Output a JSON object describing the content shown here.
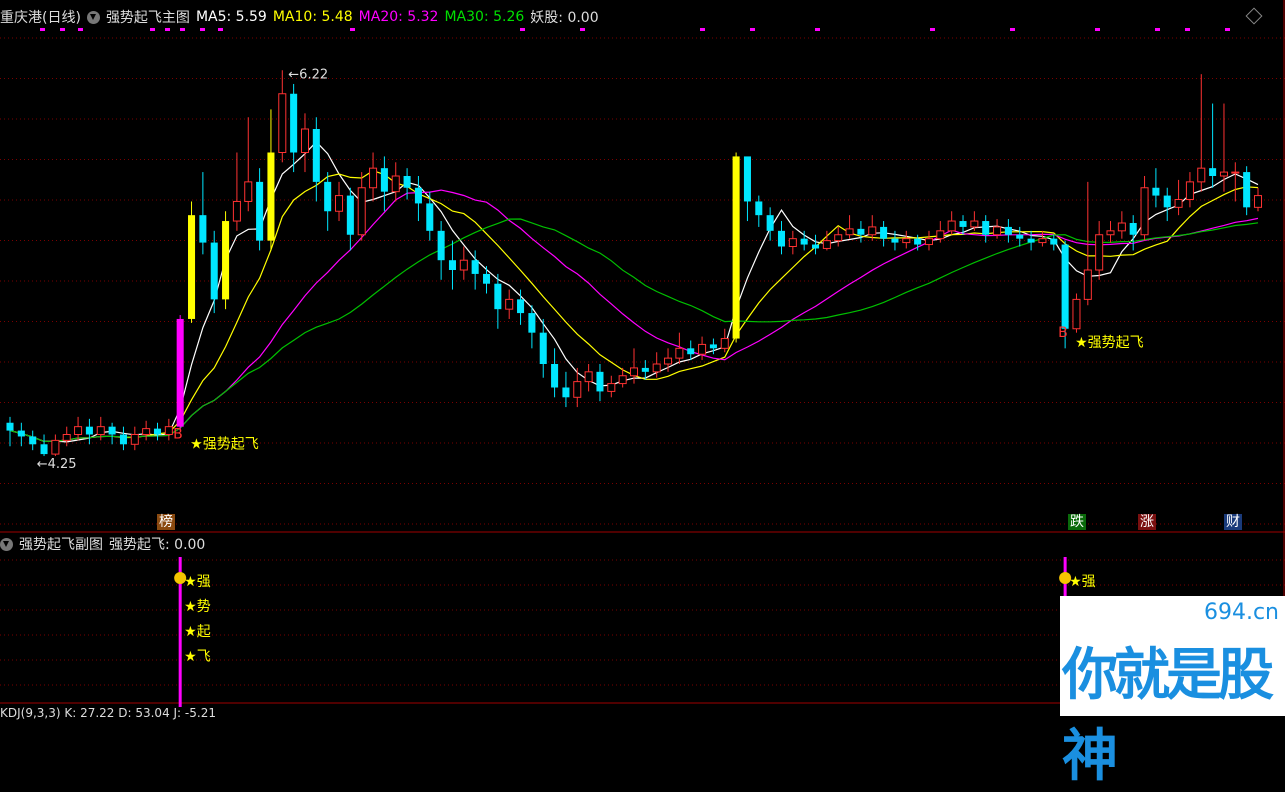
{
  "main_header": {
    "title": "重庆港(日线)",
    "indicator_name": "强势起飞主图",
    "ma5": "MA5: 5.59",
    "ma10": "MA10: 5.48",
    "ma20": "MA20: 5.32",
    "ma30": "MA30: 5.26",
    "yaogu": "妖股: 0.00"
  },
  "sub_header": {
    "indicator_name": "强势起飞副图",
    "value": "强势起飞: 0.00"
  },
  "bottom_header": {
    "text": "KDJ(9,3,3)  K: 27.22  D: 53.04  J: -5.21"
  },
  "badges": {
    "bang": "榜",
    "die": "跌",
    "zhang": "涨",
    "cai": "财"
  },
  "watermark": {
    "site": "694.cn",
    "slogan": "你就是股神"
  },
  "colors": {
    "up": "#ff3232",
    "down": "#00e6ff",
    "ma5": "#ffffff",
    "ma10": "#ffff00",
    "ma20": "#ff00ff",
    "ma30": "#00c000",
    "yellow_bar": "#ffff00",
    "magenta_bar": "#ff00ff",
    "grid": "#7a0000"
  },
  "chart_data": {
    "type": "candlestick",
    "price_range": [
      4.0,
      6.4
    ],
    "annotations": {
      "high_label": "6.22",
      "low_label": "4.25",
      "signal_text": "★强势起飞",
      "buy_mark": "B"
    },
    "sub_labels": [
      "★强",
      "★势",
      "★起",
      "★飞"
    ],
    "sub_label_single": "★强",
    "candles": [
      [
        4.42,
        4.38,
        4.45,
        4.3
      ],
      [
        4.38,
        4.35,
        4.42,
        4.3
      ],
      [
        4.35,
        4.31,
        4.38,
        4.28
      ],
      [
        4.31,
        4.26,
        4.36,
        4.25
      ],
      [
        4.26,
        4.33,
        4.36,
        4.25
      ],
      [
        4.33,
        4.36,
        4.4,
        4.3
      ],
      [
        4.36,
        4.4,
        4.45,
        4.33
      ],
      [
        4.4,
        4.36,
        4.44,
        4.31
      ],
      [
        4.36,
        4.4,
        4.45,
        4.33
      ],
      [
        4.4,
        4.36,
        4.42,
        4.31
      ],
      [
        4.36,
        4.31,
        4.4,
        4.28
      ],
      [
        4.31,
        4.36,
        4.4,
        4.28
      ],
      [
        4.36,
        4.39,
        4.43,
        4.33
      ],
      [
        4.39,
        4.36,
        4.42,
        4.33
      ],
      [
        4.36,
        4.4,
        4.44,
        4.33
      ],
      [
        4.4,
        4.95,
        4.97,
        4.38
      ],
      [
        4.95,
        5.48,
        5.55,
        4.93
      ],
      [
        5.48,
        5.34,
        5.7,
        5.28
      ],
      [
        5.34,
        5.05,
        5.4,
        4.98
      ],
      [
        5.05,
        5.45,
        5.5,
        5.0
      ],
      [
        5.45,
        5.55,
        5.8,
        5.4
      ],
      [
        5.55,
        5.65,
        5.98,
        5.5
      ],
      [
        5.65,
        5.35,
        5.72,
        5.3
      ],
      [
        5.35,
        5.8,
        6.02,
        5.3
      ],
      [
        5.8,
        6.1,
        6.22,
        5.75
      ],
      [
        6.1,
        5.8,
        6.15,
        5.7
      ],
      [
        5.8,
        5.92,
        6.0,
        5.7
      ],
      [
        5.92,
        5.65,
        5.98,
        5.55
      ],
      [
        5.65,
        5.5,
        5.7,
        5.4
      ],
      [
        5.5,
        5.58,
        5.65,
        5.45
      ],
      [
        5.58,
        5.38,
        5.62,
        5.3
      ],
      [
        5.38,
        5.62,
        5.7,
        5.35
      ],
      [
        5.62,
        5.72,
        5.8,
        5.55
      ],
      [
        5.72,
        5.6,
        5.78,
        5.5
      ],
      [
        5.6,
        5.68,
        5.75,
        5.55
      ],
      [
        5.68,
        5.62,
        5.72,
        5.56
      ],
      [
        5.62,
        5.54,
        5.68,
        5.45
      ],
      [
        5.54,
        5.4,
        5.6,
        5.35
      ],
      [
        5.4,
        5.25,
        5.45,
        5.15
      ],
      [
        5.25,
        5.2,
        5.35,
        5.1
      ],
      [
        5.2,
        5.25,
        5.32,
        5.15
      ],
      [
        5.25,
        5.18,
        5.3,
        5.1
      ],
      [
        5.18,
        5.13,
        5.22,
        5.08
      ],
      [
        5.13,
        5.0,
        5.18,
        4.9
      ],
      [
        5.0,
        5.05,
        5.1,
        4.95
      ],
      [
        5.05,
        4.98,
        5.1,
        4.92
      ],
      [
        4.98,
        4.88,
        5.02,
        4.8
      ],
      [
        4.88,
        4.72,
        4.95,
        4.65
      ],
      [
        4.72,
        4.6,
        4.8,
        4.55
      ],
      [
        4.6,
        4.55,
        4.68,
        4.5
      ],
      [
        4.55,
        4.63,
        4.7,
        4.5
      ],
      [
        4.63,
        4.68,
        4.72,
        4.58
      ],
      [
        4.68,
        4.58,
        4.72,
        4.53
      ],
      [
        4.58,
        4.62,
        4.66,
        4.55
      ],
      [
        4.62,
        4.66,
        4.7,
        4.6
      ],
      [
        4.66,
        4.7,
        4.8,
        4.62
      ],
      [
        4.7,
        4.68,
        4.74,
        4.64
      ],
      [
        4.68,
        4.72,
        4.78,
        4.65
      ],
      [
        4.72,
        4.75,
        4.8,
        4.68
      ],
      [
        4.75,
        4.8,
        4.88,
        4.72
      ],
      [
        4.8,
        4.77,
        4.84,
        4.74
      ],
      [
        4.77,
        4.82,
        4.86,
        4.74
      ],
      [
        4.82,
        4.8,
        4.85,
        4.77
      ],
      [
        4.8,
        4.85,
        4.9,
        4.78
      ],
      [
        4.85,
        5.78,
        5.8,
        4.83
      ],
      [
        5.78,
        5.55,
        5.6,
        5.45
      ],
      [
        5.55,
        5.48,
        5.58,
        5.42
      ],
      [
        5.48,
        5.4,
        5.52,
        5.35
      ],
      [
        5.4,
        5.32,
        5.45,
        5.28
      ],
      [
        5.32,
        5.36,
        5.4,
        5.28
      ],
      [
        5.36,
        5.33,
        5.4,
        5.3
      ],
      [
        5.33,
        5.31,
        5.38,
        5.28
      ],
      [
        5.31,
        5.35,
        5.4,
        5.3
      ],
      [
        5.35,
        5.38,
        5.42,
        5.32
      ],
      [
        5.38,
        5.41,
        5.48,
        5.36
      ],
      [
        5.41,
        5.38,
        5.45,
        5.34
      ],
      [
        5.38,
        5.42,
        5.48,
        5.35
      ],
      [
        5.42,
        5.36,
        5.45,
        5.32
      ],
      [
        5.36,
        5.34,
        5.4,
        5.3
      ],
      [
        5.34,
        5.36,
        5.4,
        5.31
      ],
      [
        5.36,
        5.33,
        5.38,
        5.3
      ],
      [
        5.33,
        5.36,
        5.4,
        5.3
      ],
      [
        5.36,
        5.4,
        5.45,
        5.34
      ],
      [
        5.4,
        5.45,
        5.5,
        5.38
      ],
      [
        5.45,
        5.42,
        5.48,
        5.38
      ],
      [
        5.42,
        5.45,
        5.5,
        5.4
      ],
      [
        5.45,
        5.38,
        5.48,
        5.34
      ],
      [
        5.38,
        5.42,
        5.46,
        5.36
      ],
      [
        5.42,
        5.38,
        5.46,
        5.34
      ],
      [
        5.38,
        5.36,
        5.42,
        5.32
      ],
      [
        5.36,
        5.34,
        5.4,
        5.3
      ],
      [
        5.34,
        5.36,
        5.4,
        5.32
      ],
      [
        5.36,
        5.33,
        5.38,
        5.3
      ],
      [
        5.33,
        4.9,
        5.35,
        4.8
      ],
      [
        4.9,
        5.05,
        5.08,
        4.88
      ],
      [
        5.05,
        5.2,
        5.65,
        5.02
      ],
      [
        5.2,
        5.38,
        5.45,
        5.15
      ],
      [
        5.38,
        5.4,
        5.45,
        5.34
      ],
      [
        5.4,
        5.44,
        5.5,
        5.36
      ],
      [
        5.44,
        5.38,
        5.48,
        5.3
      ],
      [
        5.38,
        5.62,
        5.68,
        5.35
      ],
      [
        5.62,
        5.58,
        5.72,
        5.52
      ],
      [
        5.58,
        5.52,
        5.62,
        5.45
      ],
      [
        5.52,
        5.56,
        5.66,
        5.48
      ],
      [
        5.56,
        5.65,
        5.7,
        5.52
      ],
      [
        5.65,
        5.72,
        6.2,
        5.6
      ],
      [
        5.72,
        5.68,
        6.05,
        5.62
      ],
      [
        5.68,
        5.7,
        6.05,
        5.6
      ],
      [
        5.7,
        5.7,
        5.75,
        5.55
      ],
      [
        5.7,
        5.52,
        5.73,
        5.48
      ],
      [
        5.52,
        5.58,
        5.62,
        5.5
      ]
    ]
  }
}
